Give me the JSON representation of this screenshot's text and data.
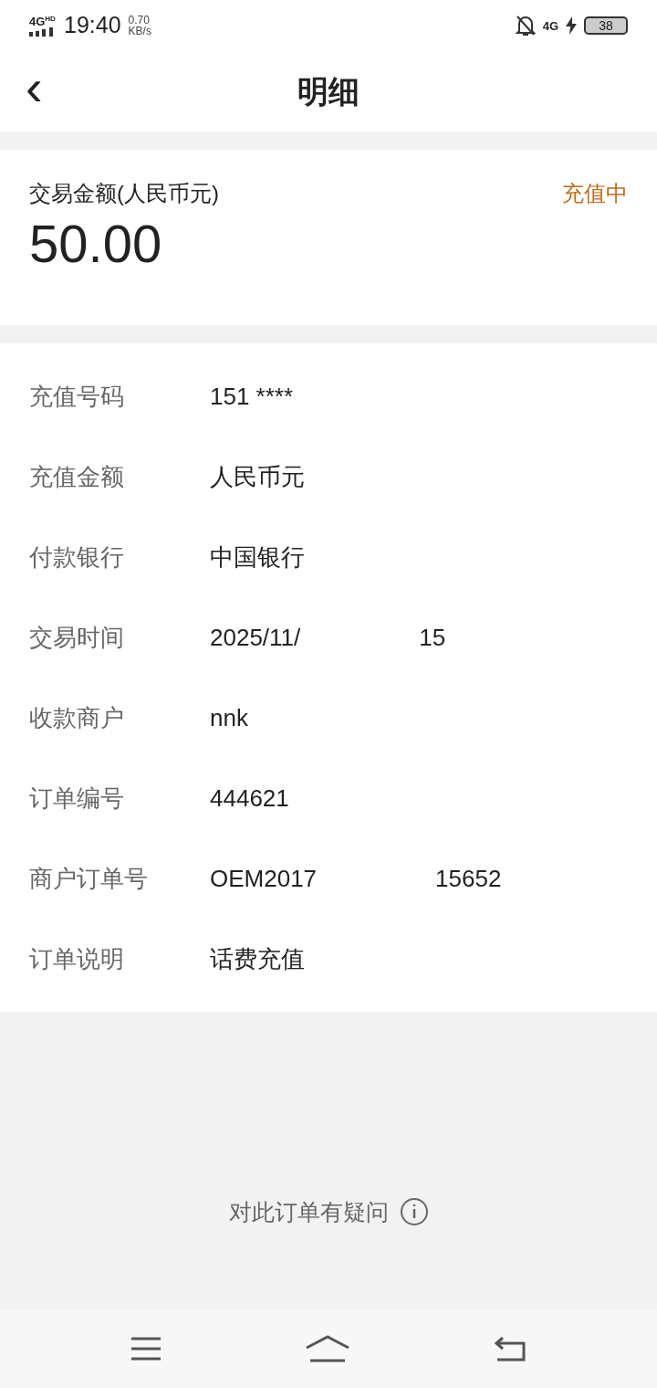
{
  "status_bar": {
    "network": "4G",
    "network_badge": "HD",
    "time": "19:40",
    "speed_value": "0.70",
    "speed_unit": "KB/s",
    "data_type": "4G",
    "battery": "38"
  },
  "header": {
    "back": "‹",
    "title": "明细"
  },
  "summary": {
    "label": "交易金额(人民币元)",
    "status": "充值中",
    "amount": "50.00"
  },
  "details": [
    {
      "label": "充值号码",
      "value": "151 ****"
    },
    {
      "label": "充值金额",
      "value": "人民币元"
    },
    {
      "label": "付款银行",
      "value": "中国银行"
    },
    {
      "label": "交易时间",
      "value": "2025/11/",
      "tail": "15"
    },
    {
      "label": "收款商户",
      "value": "nnk"
    },
    {
      "label": "订单编号",
      "value": "444621"
    },
    {
      "label": "商户订单号",
      "value": "OEM2017",
      "tail": "15652"
    },
    {
      "label": "订单说明",
      "value": "话费充值"
    }
  ],
  "help_link": "对此订单有疑问",
  "nav": [
    {
      "kind": "menu"
    },
    {
      "kind": "home"
    },
    {
      "kind": "back"
    }
  ]
}
